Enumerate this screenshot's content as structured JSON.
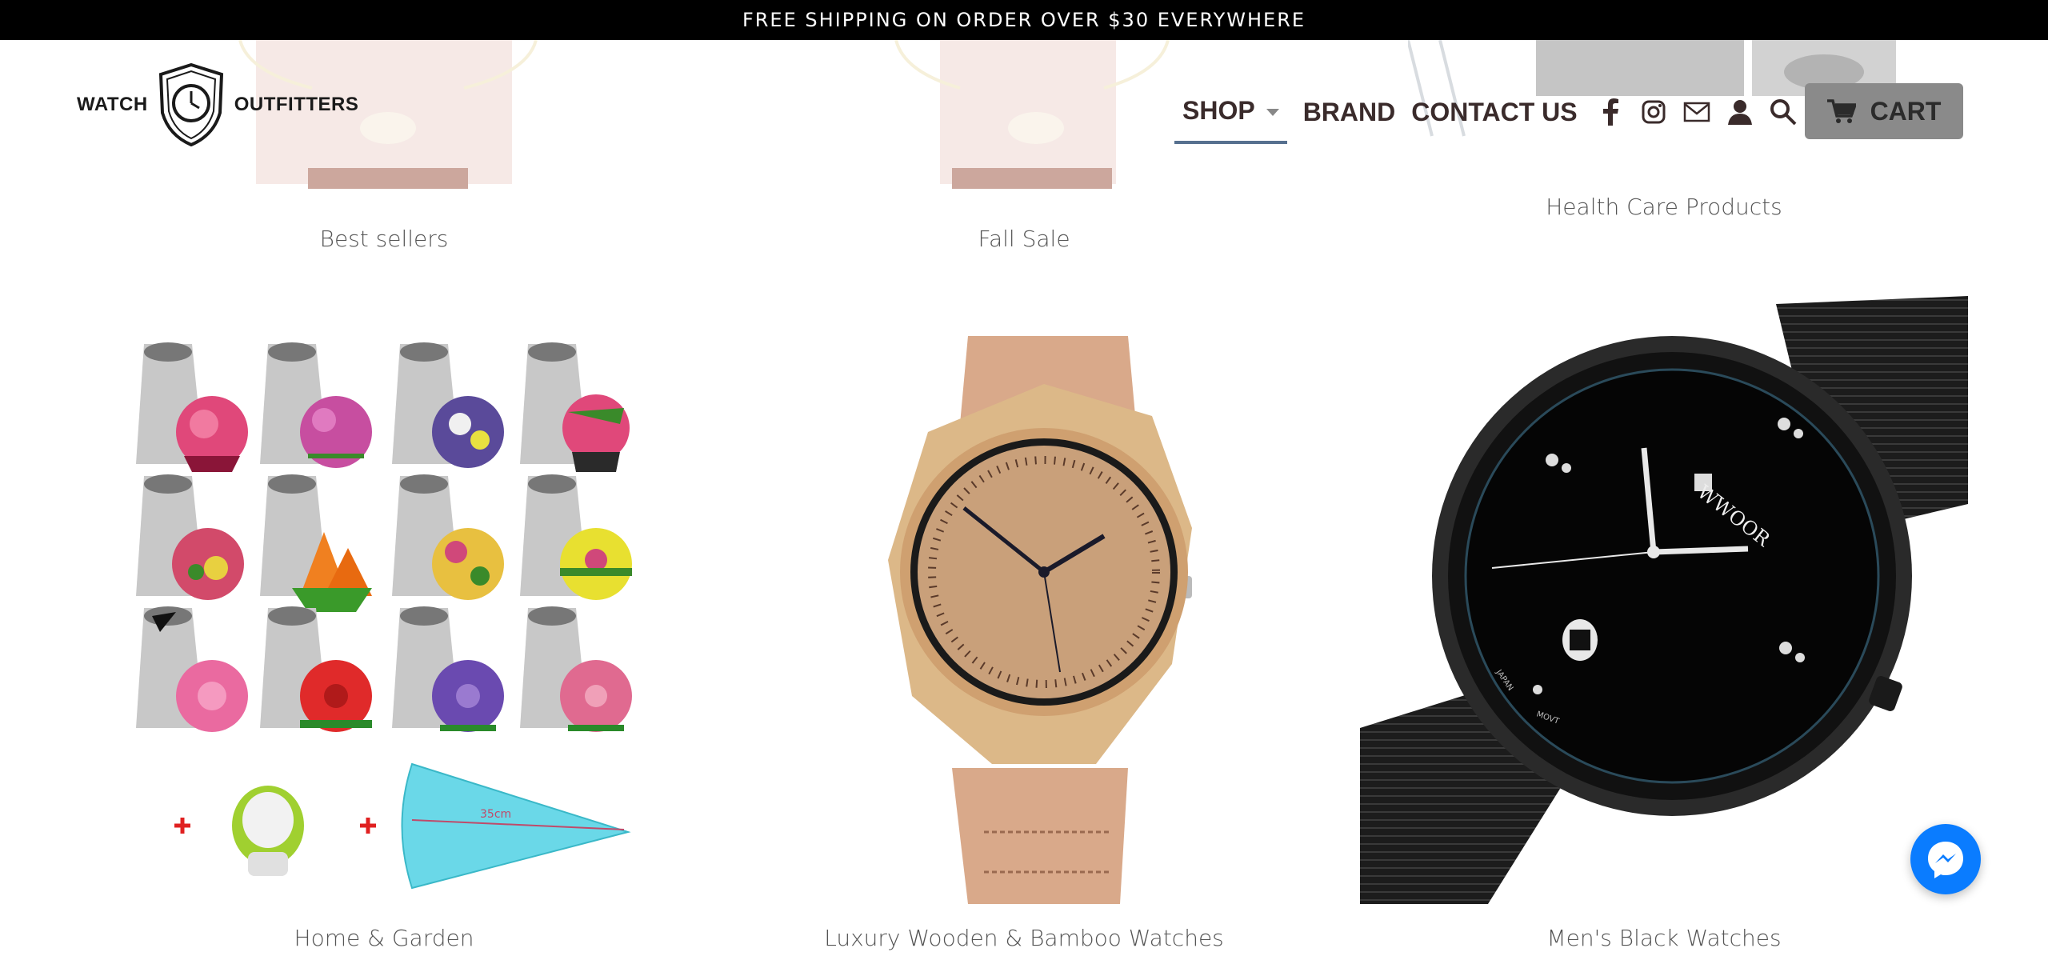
{
  "announcement": {
    "text": "FREE SHIPPING ON ORDER OVER $30 EVERYWHERE"
  },
  "logo": {
    "left_word": "WATCH",
    "right_word": "OUTFITTERS"
  },
  "nav": {
    "shop": "SHOP",
    "brand": "BRAND",
    "contact": "CONTACT US",
    "icons": [
      "facebook-icon",
      "instagram-icon",
      "email-icon",
      "account-icon",
      "search-icon"
    ],
    "cart": "CART"
  },
  "collections_top": [
    {
      "label": "Best sellers"
    },
    {
      "label": "Fall Sale"
    },
    {
      "label": "Health Care Products"
    }
  ],
  "collections": [
    {
      "label": "Home & Garden",
      "image_note": "35cm"
    },
    {
      "label": "Luxury Wooden & Bamboo Watches"
    },
    {
      "label": "Men's Black Watches",
      "brand_on_dial": "WWOOR",
      "dial_text": [
        "JAPAN",
        "MOVT"
      ]
    }
  ],
  "colors": {
    "announcement_bg": "#000000",
    "nav_text": "#3a2b2b",
    "shop_underline": "#56708f",
    "cart_bg": "#8a8a8a",
    "messenger": "#0a7cff"
  }
}
